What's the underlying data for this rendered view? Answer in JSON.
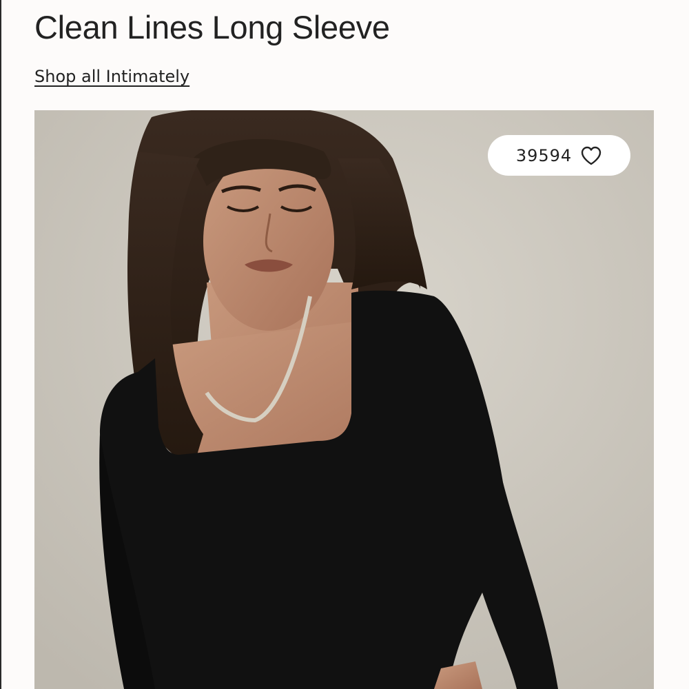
{
  "product": {
    "title": "Clean Lines Long Sleeve",
    "shop_all_link": "Shop all Intimately"
  },
  "gallery": {
    "favorites_count": "39594",
    "favorite_icon": "heart-outline-icon",
    "image_subject": "model wearing black square-neck long sleeve top"
  },
  "colors": {
    "page_background": "#fdfbfa",
    "text": "#222222",
    "photo_background": "#ccc7bd",
    "garment": "#111111"
  }
}
